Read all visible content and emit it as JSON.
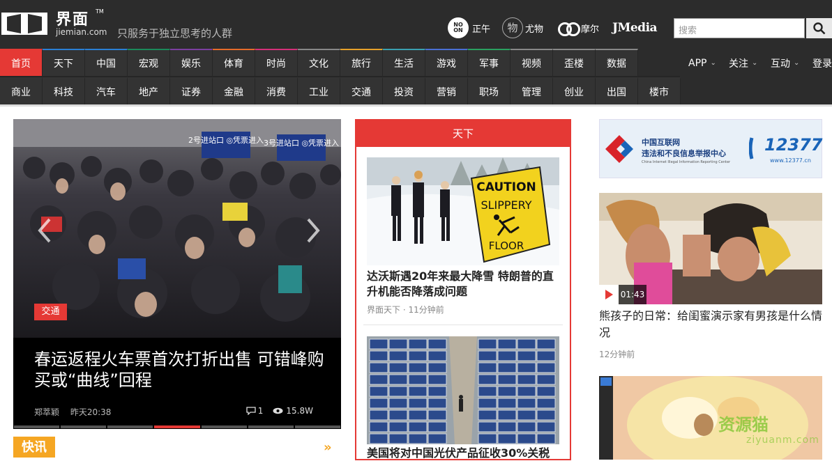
{
  "header": {
    "logo_title": "界面",
    "logo_tm": "TM",
    "logo_domain": "jiemian.com",
    "slogan": "只服务于独立思考的人群",
    "brands": {
      "noon_badge": "NO ON",
      "noon_label": "正午",
      "youwu_badge": "物",
      "youwu_label": "尤物",
      "moer_label": "摩尔",
      "jmedia_label": "JMedia"
    },
    "search": {
      "placeholder": "搜索",
      "icon": "search-icon"
    }
  },
  "nav": {
    "row1": [
      "首页",
      "天下",
      "中国",
      "宏观",
      "娱乐",
      "体育",
      "时尚",
      "文化",
      "旅行",
      "生活",
      "游戏",
      "军事",
      "视频",
      "歪楼",
      "数据"
    ],
    "row2": [
      "商业",
      "科技",
      "汽车",
      "地产",
      "证券",
      "金融",
      "消费",
      "工业",
      "交通",
      "投资",
      "营销",
      "职场",
      "管理",
      "创业",
      "出国",
      "楼市"
    ],
    "row1_colors": [
      "#e53935",
      "#2a7fd4",
      "#2a7fd4",
      "#1b8a5a",
      "#7b3fa0",
      "#e56b2a",
      "#d4307a",
      "#888888",
      "#e6a12a",
      "#3aa0b0",
      "#4a6fd4",
      "#2aa060",
      "#888888",
      "#888888",
      "#888888"
    ],
    "active_index": 0,
    "right": [
      {
        "label": "APP",
        "caret": "▼"
      },
      {
        "label": "关注",
        "caret": "▼"
      },
      {
        "label": "互动",
        "caret": "▼"
      },
      {
        "label": "登录",
        "caret": ""
      }
    ]
  },
  "hero": {
    "tag": "交通",
    "sign1": "2号进站口 ◎凭票进入",
    "sign2": "3号进站口 ◎凭票进入",
    "title": "春运返程火车票首次打折出售 可错峰购买或“曲线”回程",
    "author": "郑萃颖",
    "time": "昨天20:38",
    "comments": "1",
    "views": "15.8W",
    "dots": 7,
    "active_dot": 3
  },
  "kuaixun": {
    "label": "快讯",
    "more": "»"
  },
  "tianxia": {
    "header": "天下",
    "articles": [
      {
        "title": "达沃斯遇20年来最大降雪 特朗普的直升机能否降落成问题",
        "source": "界面天下",
        "time": "11分钟前",
        "sign_line1": "CAUTION",
        "sign_line2": "SLIPPERY",
        "sign_line3": "FLOOR"
      },
      {
        "title": "美国将对中国光伏产品征收30%关税"
      }
    ]
  },
  "right": {
    "ad": {
      "org": "中国互联网",
      "org2": "违法和不良信息举报中心",
      "org_en": "China Internet Illegal Information Reporting Center",
      "phone": "12377",
      "url": "www.12377.cn"
    },
    "video": {
      "duration": "01:43",
      "title": "熊孩子的日常：给闺蜜演示家有男孩是什么情况",
      "time": "12分钟前"
    },
    "watermark": {
      "main": "资源猫",
      "sub": "ziyuanm.com"
    }
  },
  "colors": {
    "accent": "#e53935",
    "nav_bg": "#2c2c2c",
    "kuaixun": "#f5a623"
  }
}
